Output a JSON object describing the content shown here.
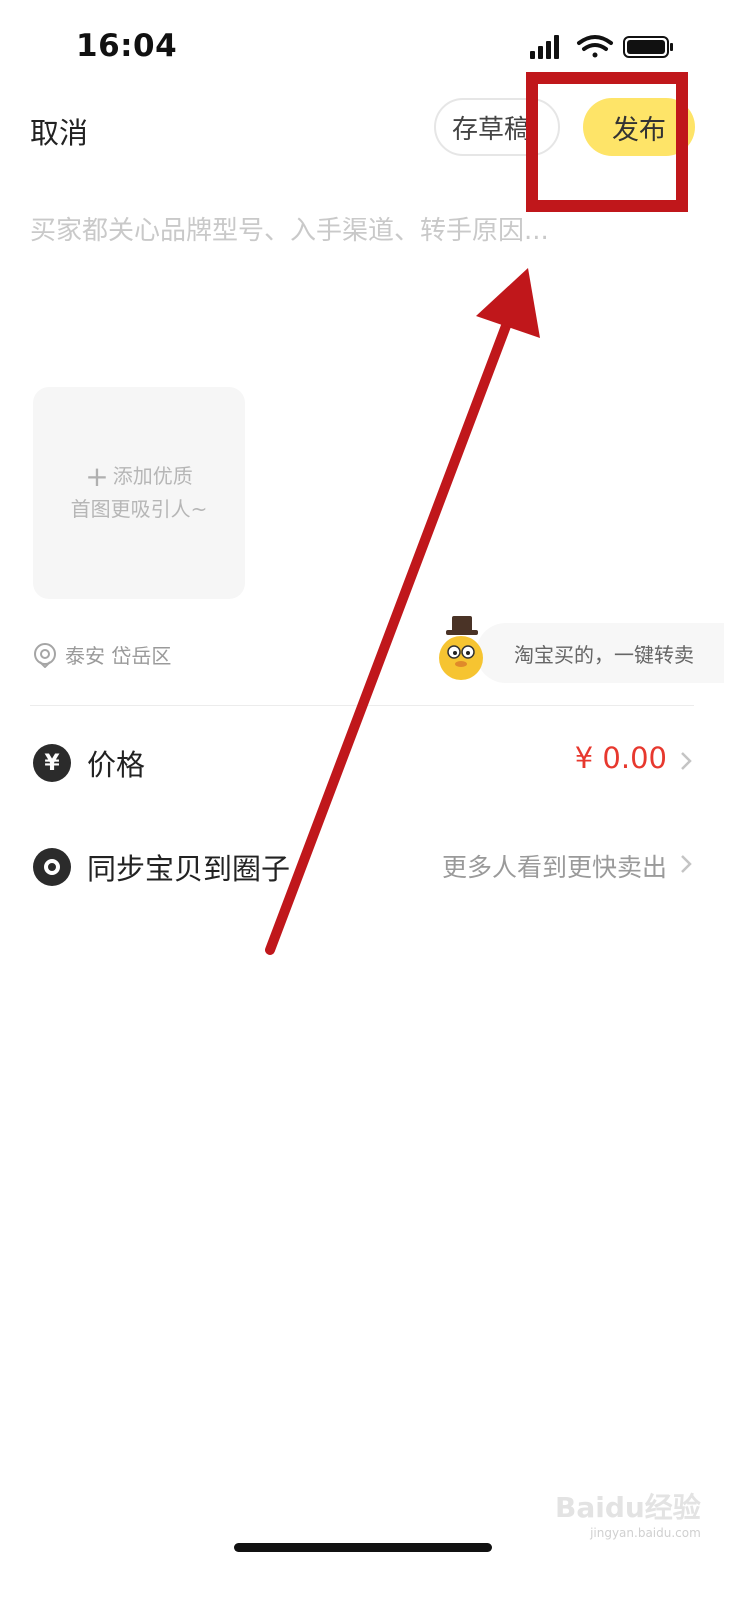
{
  "status_bar": {
    "time": "16:04"
  },
  "header": {
    "cancel": "取消",
    "draft": "存草稿",
    "publish": "发布"
  },
  "description": {
    "placeholder": "买家都关心品牌型号、入手渠道、转手原因..."
  },
  "add_photo": {
    "line1": "添加优质",
    "line2": "首图更吸引人~"
  },
  "location": {
    "text": "泰安 岱岳区"
  },
  "resell": {
    "text": "淘宝买的，一键转卖"
  },
  "price_row": {
    "label": "价格",
    "value": "¥ 0.00",
    "icon_glyph": "¥"
  },
  "sync_row": {
    "label": "同步宝贝到圈子",
    "hint": "更多人看到更快卖出"
  },
  "watermark": {
    "brand": "Baidu经验",
    "url": "jingyan.baidu.com"
  },
  "colors": {
    "publish_bg": "#fee468",
    "price_red": "#e7382e",
    "annotation_red": "#c0171b"
  },
  "icons": [
    "location-pin-icon",
    "yen-icon",
    "circle-dot-icon",
    "chevron-right-icon",
    "signal-icon",
    "wifi-icon",
    "battery-icon",
    "plus-icon"
  ]
}
